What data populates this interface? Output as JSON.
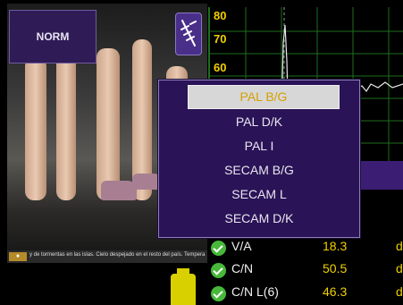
{
  "norm_button": {
    "label": "NORM"
  },
  "spectrum": {
    "y_ticks": [
      "80",
      "70",
      "60"
    ]
  },
  "ticker": {
    "text": "y de tormentas en las islas.  Cielo despejado en el resto del país.  Tempera"
  },
  "standard_menu": {
    "items": [
      "PAL B/G",
      "PAL D/K",
      "PAL I",
      "SECAM B/G",
      "SECAM L",
      "SECAM D/K"
    ],
    "selected": "PAL B/G"
  },
  "measurements": [
    {
      "name": "V/A",
      "value": "18.3",
      "unit": "dE"
    },
    {
      "name": "C/N",
      "value": "50.5",
      "unit": "dE"
    },
    {
      "name": "C/N L(6)",
      "value": "46.3",
      "unit": "dE"
    }
  ],
  "colors": {
    "accent": "#2a1357",
    "value": "#f0d000",
    "check": "#47b83a",
    "grid": "#1e6e1e"
  }
}
